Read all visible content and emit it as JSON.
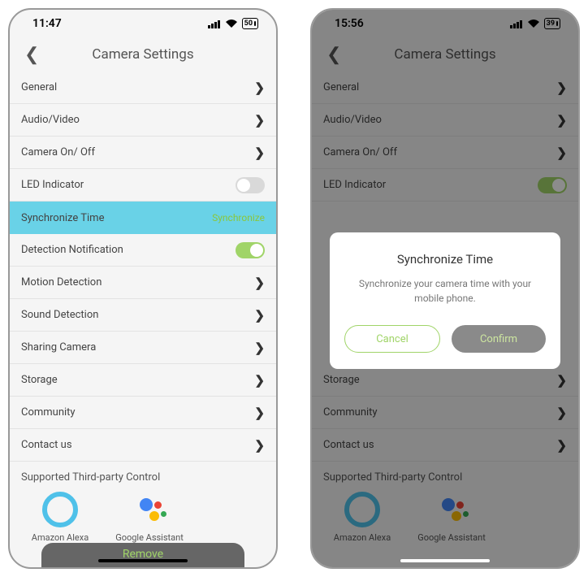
{
  "left": {
    "status": {
      "time": "11:47",
      "battery": "50"
    },
    "title": "Camera Settings",
    "items": {
      "general": "General",
      "audiovideo": "Audio/Video",
      "cameraonoff": "Camera On/ Off",
      "led": "LED Indicator",
      "synctime": "Synchronize Time",
      "synctime_side": "Synchronize",
      "detection_notif": "Detection Notification",
      "motion": "Motion Detection",
      "sound": "Sound Detection",
      "sharing": "Sharing Camera",
      "storage": "Storage",
      "community": "Community",
      "contact": "Contact us"
    },
    "thirdparty": {
      "title": "Supported Third-party Control",
      "alexa": "Amazon Alexa",
      "assistant": "Google Assistant"
    },
    "remove": "Remove"
  },
  "right": {
    "status": {
      "time": "15:56",
      "battery": "39"
    },
    "title": "Camera Settings",
    "items": {
      "general": "General",
      "audiovideo": "Audio/Video",
      "cameraonoff": "Camera On/ Off",
      "led": "LED Indicator",
      "storage": "Storage",
      "community": "Community",
      "contact": "Contact us"
    },
    "thirdparty": {
      "title": "Supported Third-party Control",
      "alexa": "Amazon Alexa",
      "assistant": "Google Assistant"
    },
    "dialog": {
      "title": "Synchronize Time",
      "message": "Synchronize your camera time with your mobile phone.",
      "cancel": "Cancel",
      "confirm": "Confirm"
    }
  }
}
